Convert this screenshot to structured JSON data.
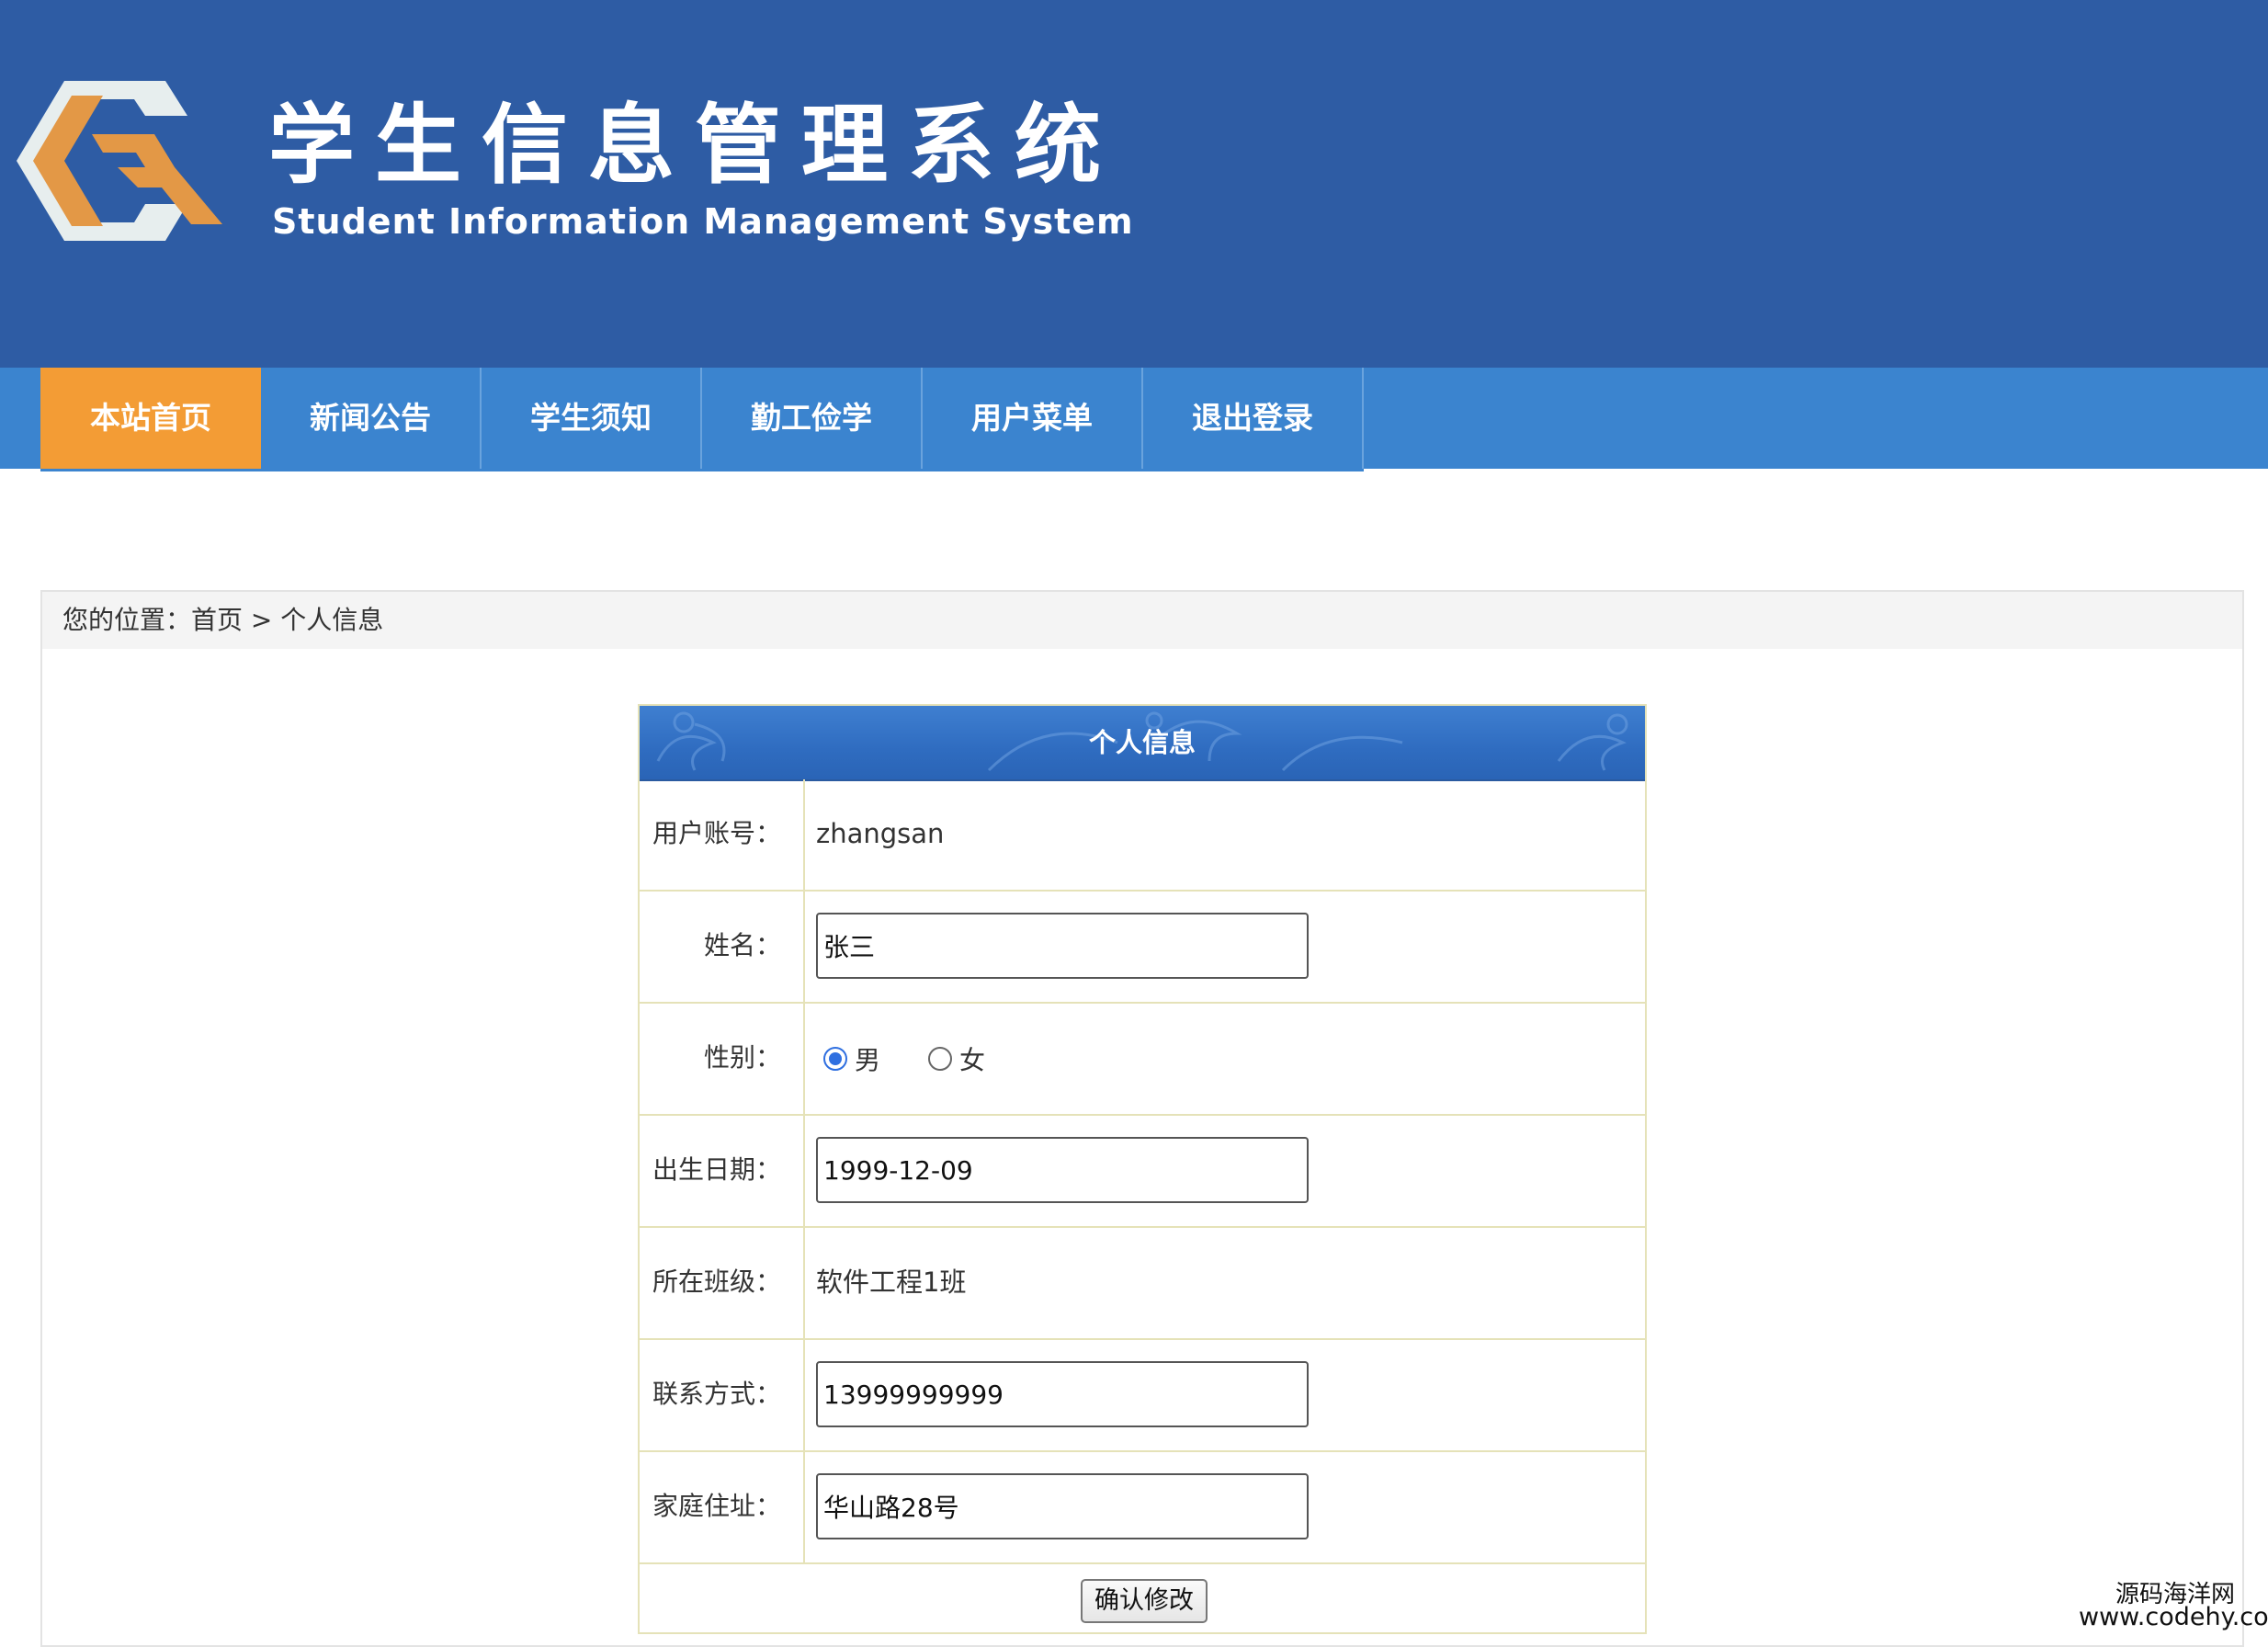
{
  "header": {
    "title_cn": "学生信息管理系统",
    "title_en": "Student Information Management System",
    "logo_icon": "hexagon-g-logo"
  },
  "nav": {
    "items": [
      {
        "label": "本站首页",
        "active": true
      },
      {
        "label": "新闻公告",
        "active": false
      },
      {
        "label": "学生须知",
        "active": false
      },
      {
        "label": "勤工俭学",
        "active": false
      },
      {
        "label": "用户菜单",
        "active": false
      },
      {
        "label": "退出登录",
        "active": false
      }
    ]
  },
  "breadcrumb": "您的位置：首页 > 个人信息",
  "panel": {
    "title": "个人信息",
    "fields": {
      "account": {
        "label": "用户账号：",
        "value": "zhangsan"
      },
      "name": {
        "label": "姓名：",
        "value": "张三"
      },
      "gender": {
        "label": "性别：",
        "options": [
          "男",
          "女"
        ],
        "selected": "男"
      },
      "birthday": {
        "label": "出生日期：",
        "value": "1999-12-09"
      },
      "class": {
        "label": "所在班级：",
        "value": "软件工程1班"
      },
      "phone": {
        "label": "联系方式：",
        "value": "13999999999"
      },
      "address": {
        "label": "家庭住址：",
        "value": "华山路28号"
      }
    },
    "submit_label": "确认修改"
  },
  "watermark": {
    "line1": "源码海洋网",
    "line2": "www.codehy.com"
  },
  "colors": {
    "banner": "#2e5ca4",
    "nav": "#3b84cf",
    "nav_active": "#f39c35",
    "panel_border": "#e5e2b8"
  }
}
